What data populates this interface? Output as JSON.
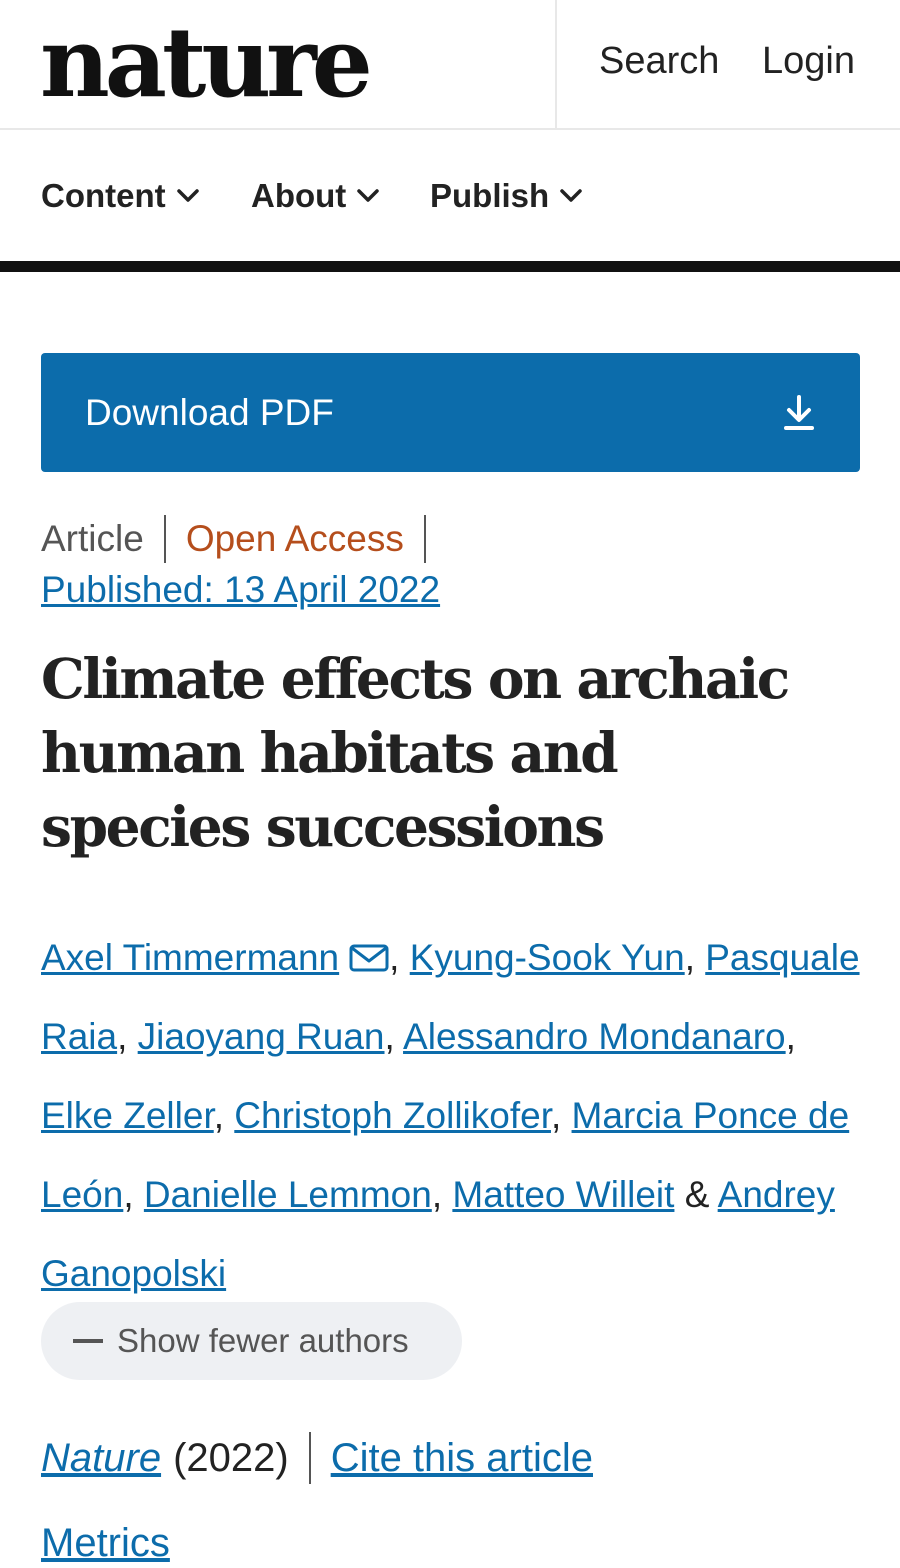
{
  "header": {
    "logo": "nature",
    "search_label": "Search",
    "login_label": "Login"
  },
  "menu": {
    "items": [
      {
        "label": "Content"
      },
      {
        "label": "About"
      },
      {
        "label": "Publish"
      }
    ]
  },
  "download": {
    "label": "Download PDF",
    "icon": "download-icon"
  },
  "article": {
    "type": "Article",
    "access": "Open Access",
    "published": "Published: 13 April 2022",
    "title": "Climate effects on archaic human habitats and species successions"
  },
  "authors": {
    "list": [
      "Axel Timmermann",
      "Kyung-Sook Yun",
      "Pasquale Raia",
      "Jiaoyang Ruan",
      "Alessandro Mondanaro",
      "Elke Zeller",
      "Christoph Zollikofer",
      "Marcia Ponce de León",
      "Danielle Lemmon",
      "Matteo Willeit",
      "Andrey Ganopolski"
    ],
    "comma": ",",
    "ampersand": "&",
    "show_fewer_label": "Show fewer authors"
  },
  "journal": {
    "name": "Nature",
    "year": "(2022)",
    "cite_label": "Cite this article",
    "metrics_label": "Metrics"
  },
  "colors": {
    "link": "#0c6cab",
    "open_access": "#b54e1c",
    "download_button": "#0c6cab"
  }
}
